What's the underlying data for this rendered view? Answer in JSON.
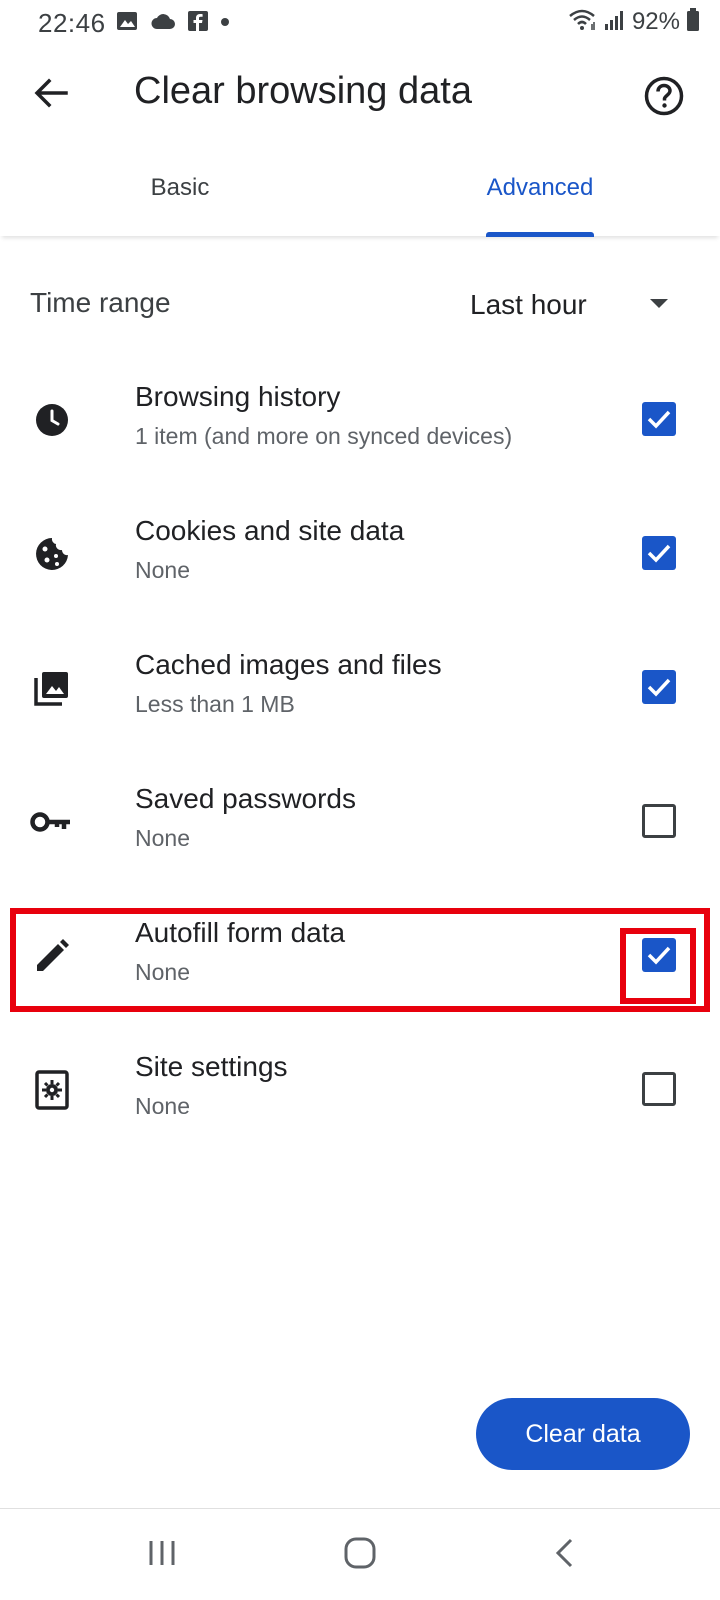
{
  "status_bar": {
    "time": "22:46",
    "battery": "92%",
    "left_icons": [
      "image-icon",
      "cloud-icon",
      "facebook-icon",
      "dot-icon"
    ],
    "right_icons": [
      "wifi-icon",
      "signal-icon",
      "battery-icon"
    ]
  },
  "header": {
    "title": "Clear browsing data",
    "back_icon": "arrow-back-icon",
    "help_icon": "help-circle-icon"
  },
  "tabs": [
    {
      "label": "Basic",
      "selected": false
    },
    {
      "label": "Advanced",
      "selected": true
    }
  ],
  "time_range": {
    "label": "Time range",
    "value": "Last hour"
  },
  "items": [
    {
      "icon": "clock-icon",
      "title": "Browsing history",
      "subtitle": "1 item (and more on synced devices)",
      "checked": true
    },
    {
      "icon": "cookie-icon",
      "title": "Cookies and site data",
      "subtitle": "None",
      "checked": true
    },
    {
      "icon": "images-icon",
      "title": "Cached images and files",
      "subtitle": "Less than 1 MB",
      "checked": true
    },
    {
      "icon": "key-icon",
      "title": "Saved passwords",
      "subtitle": "None",
      "checked": false
    },
    {
      "icon": "pencil-icon",
      "title": "Autofill form data",
      "subtitle": "None",
      "checked": true
    },
    {
      "icon": "site-settings-icon",
      "title": "Site settings",
      "subtitle": "None",
      "checked": false
    }
  ],
  "highlight": {
    "target": "Autofill form data",
    "color": "#e8000d"
  },
  "actions": {
    "clear_data_label": "Clear data"
  },
  "colors": {
    "accent": "#1a56c8",
    "text_primary": "#202124",
    "text_secondary": "#5f6368"
  },
  "nav_bar": {
    "buttons": [
      "recent-apps-icon",
      "home-icon",
      "back-nav-icon"
    ]
  }
}
